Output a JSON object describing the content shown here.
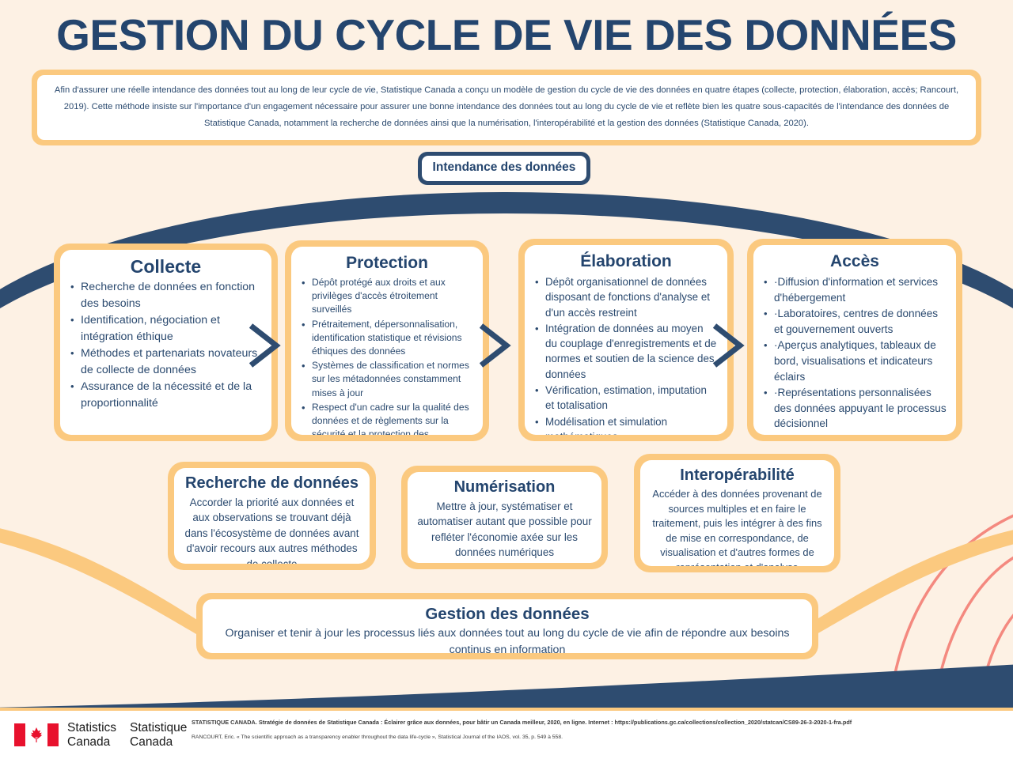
{
  "page": {
    "title": "GESTION DU CYCLE DE VIE DES DONNÉES",
    "background_color": "#fdf1e4",
    "accent_navy": "#2e4c70",
    "accent_orange": "#fbc97f",
    "accent_coral": "#f4897f",
    "card_fill": "#ffffff"
  },
  "intro": {
    "text": "Afin d'assurer une réelle intendance des données tout au long de leur cycle de vie, Statistique Canada a conçu un modèle de gestion du cycle de vie des données en quatre étapes (collecte, protection, élaboration, accès; Rancourt, 2019). Cette méthode insiste sur l'importance d'un engagement nécessaire pour assurer une bonne intendance des données tout au long du cycle de vie et reflète bien les quatre sous-capacités de l'intendance des données de Statistique Canada, notamment la recherche de données ainsi que la numérisation, l'interopérabilité et la gestion des données (Statistique Canada, 2020)."
  },
  "stewardship": {
    "label": "Intendance des données"
  },
  "stages": [
    {
      "key": "collecte",
      "title": "Collecte",
      "bullets": [
        "Recherche de données en fonction des besoins",
        "Identification, négociation et intégration éthique",
        "Méthodes et partenariats novateurs de collecte de données",
        "Assurance de la nécessité et de la proportionnalité"
      ]
    },
    {
      "key": "protection",
      "title": "Protection",
      "bullets": [
        "Dépôt protégé aux droits et aux privilèges d'accès étroitement surveillés",
        "Prétraitement, dépersonnalisation, identification statistique et révisions éthiques des données",
        "Systèmes de classification et normes sur les métadonnées constamment mises à jour",
        "Respect d'un cadre sur la qualité des données et de règlements sur la sécurité et la protection des renseignements personnels"
      ]
    },
    {
      "key": "elaboration",
      "title": "Élaboration",
      "bullets": [
        "Dépôt organisationnel de données disposant de fonctions d'analyse et d'un accès restreint",
        "Intégration de données au moyen du couplage d'enregistrements et de normes et soutien de la science des données",
        "Vérification, estimation, imputation et totalisation",
        "Modélisation et simulation mathématiques"
      ]
    },
    {
      "key": "acces",
      "title": "Accès",
      "bullets": [
        "·Diffusion d'information et services d'hébergement",
        "·Laboratoires, centres de données et gouvernement ouverts",
        "·Aperçus analytiques, tableaux de bord, visualisations et indicateurs éclairs",
        "·Représentations personnalisées des données appuyant le processus décisionnel"
      ]
    }
  ],
  "sub_capabilities": [
    {
      "key": "recherche",
      "title": "Recherche de données",
      "text": "Accorder la priorité aux données et aux observations se trouvant déjà dans l'écosystème de données avant d'avoir recours aux autres méthodes de collecte"
    },
    {
      "key": "numerisation",
      "title": "Numérisation",
      "text": "Mettre à jour, systématiser et automatiser autant que possible pour refléter l'économie axée sur les données numériques"
    },
    {
      "key": "interoperabilite",
      "title": "Interopérabilité",
      "text": "Accéder à des données provenant de sources multiples et en faire le traitement, puis les intégrer à des fins de mise en correspondance, de visualisation et d'autres formes de représentation et d'analyse"
    }
  ],
  "management": {
    "title": "Gestion des données",
    "text": "Organiser et tenir à jour les processus liés aux données tout au long du cycle de vie afin de répondre aux besoins continus en information"
  },
  "footer": {
    "wordmark_en_line1": "Statistics",
    "wordmark_en_line2": "Canada",
    "wordmark_fr_line1": "Statistique",
    "wordmark_fr_line2": "Canada",
    "reference_1": "STATISTIQUE CANADA. Stratégie de données de Statistique Canada : Éclairer grâce aux données, pour bâtir un Canada meilleur, 2020, en ligne. Internet : https://publications.gc.ca/collections/collection_2020/statcan/CS89-26-3-2020-1-fra.pdf",
    "reference_2": "RANCOURT, Eric. « The scientific approach as a transparency enabler throughout the data life-cycle », Statistical Journal of the IAOS, vol. 35, p. 549 à 558."
  }
}
